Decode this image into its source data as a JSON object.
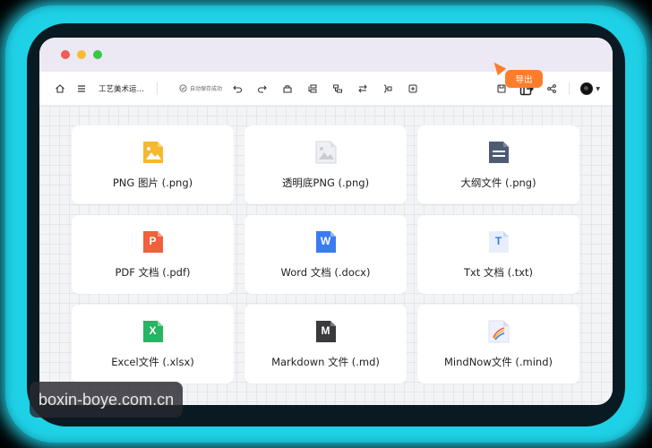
{
  "window": {
    "title_doc": "工艺美术运…",
    "save_status": "自动保存成功"
  },
  "toolbar": {
    "left_icons": [
      "home-icon",
      "menu-icon"
    ],
    "center_icons": [
      "undo-icon",
      "redo-icon",
      "format-painter-icon",
      "insert-topic-icon",
      "insert-subtopic-icon",
      "relation-icon",
      "summary-icon",
      "add-icon"
    ],
    "right_icons": [
      "save-icon",
      "export-icon",
      "share-icon",
      "avatar"
    ]
  },
  "tooltip": {
    "label": "导出"
  },
  "export_options": [
    {
      "label": "PNG 图片 (.png)",
      "icon": "png-image-icon",
      "color": "#f5b82e"
    },
    {
      "label": "透明底PNG (.png)",
      "icon": "transparent-png-icon",
      "color": "#dcdfe4"
    },
    {
      "label": "大纲文件 (.png)",
      "icon": "outline-file-icon",
      "color": "#4f5b72"
    },
    {
      "label": "PDF 文档 (.pdf)",
      "icon": "pdf-file-icon",
      "letter": "P",
      "color": "#f0603c"
    },
    {
      "label": "Word 文档 (.docx)",
      "icon": "word-file-icon",
      "letter": "W",
      "color": "#3a7cf0"
    },
    {
      "label": "Txt 文档 (.txt)",
      "icon": "txt-file-icon",
      "letter": "T",
      "color": "#e8eefb"
    },
    {
      "label": "Excel文件 (.xlsx)",
      "icon": "excel-file-icon",
      "letter": "X",
      "color": "#27b463"
    },
    {
      "label": "Markdown 文件 (.md)",
      "icon": "markdown-file-icon",
      "letter": "M",
      "color": "#3a3a3c"
    },
    {
      "label": "MindNow文件 (.mind)",
      "icon": "mindnow-file-icon",
      "color": "#eef0fb"
    }
  ],
  "watermark": "boxin-boye.com.cn",
  "colors": {
    "accent": "#ff7d2a",
    "frame_glow": "#1fd1e6"
  }
}
